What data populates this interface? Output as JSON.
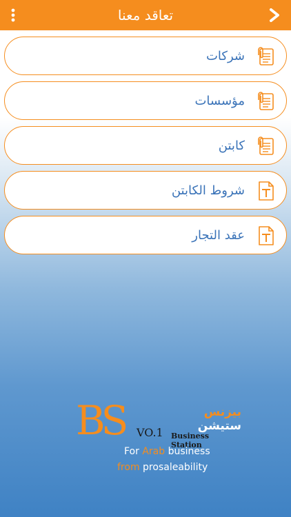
{
  "header": {
    "title": "تعاقد معنا",
    "back_icon": "chevron-right-icon",
    "menu_icon": "more-vertical-icon",
    "bar_color": "#f58d1e"
  },
  "menu": {
    "items": [
      {
        "label": "شركات",
        "icon": "paperclip-document-icon"
      },
      {
        "label": "مؤسسات",
        "icon": "paperclip-document-icon"
      },
      {
        "label": "كابتن",
        "icon": "paperclip-document-icon"
      },
      {
        "label": "شروط الكابتن",
        "icon": "text-document-icon"
      },
      {
        "label": "عقد التجار",
        "icon": "text-document-icon"
      }
    ]
  },
  "logo": {
    "mark": "BS",
    "arabic_name_part1": "بيزنس",
    "arabic_name_part2": "ستيشن",
    "version": "VO.1",
    "business_name": "Business Station",
    "tagline1_a": "For ",
    "tagline1_b": "Arab",
    "tagline1_c": " business",
    "tagline2_a": "from",
    "tagline2_b": " prosaleability"
  },
  "colors": {
    "accent": "#f58d1e",
    "label": "#3a73b8",
    "bg_bottom": "#3f82c4"
  }
}
